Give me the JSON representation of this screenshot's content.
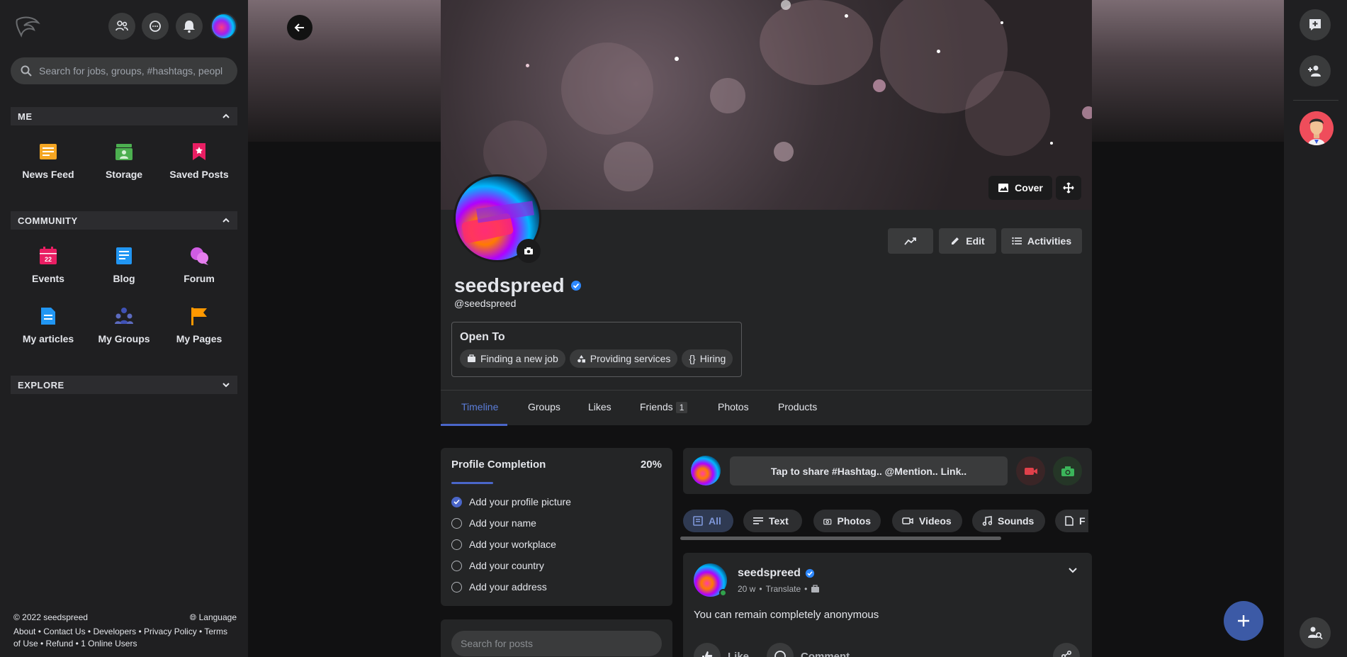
{
  "search": {
    "placeholder": "Search for jobs, groups, #hashtags, peopl"
  },
  "sections": {
    "me": "ME",
    "community": "COMMUNITY",
    "explore": "EXPLORE"
  },
  "me_items": [
    {
      "label": "News Feed",
      "color": "#f5a623"
    },
    {
      "label": "Storage",
      "color": "#4caf50"
    },
    {
      "label": "Saved Posts",
      "color": "#e91e63"
    }
  ],
  "community_items": [
    {
      "label": "Events",
      "color": "#e91e63"
    },
    {
      "label": "Blog",
      "color": "#2196f3"
    },
    {
      "label": "Forum",
      "color": "#d05ce3"
    },
    {
      "label": "My articles",
      "color": "#2196f3"
    },
    {
      "label": "My Groups",
      "color": "#3f51b5"
    },
    {
      "label": "My Pages",
      "color": "#ff9800"
    }
  ],
  "footer": {
    "copyright": "© 2022 seedspreed",
    "language": "Language",
    "links_line1": "About • Contact Us • Developers • Privacy Policy • Terms",
    "links_line2": "of Use • Refund • 1 Online Users"
  },
  "profile": {
    "cover_label": "Cover",
    "edit_label": "Edit",
    "activities_label": "Activities",
    "name": "seedspreed",
    "handle": "@seedspreed",
    "open_to_title": "Open To",
    "open_to_chips": [
      "Finding a new job",
      "Providing services",
      "Hiring"
    ],
    "tabs": [
      "Timeline",
      "Groups",
      "Likes",
      "Friends",
      "Photos",
      "Products"
    ],
    "friends_count": "1"
  },
  "completion": {
    "title": "Profile Completion",
    "percent": "20%",
    "progress": 0.2,
    "items": [
      {
        "label": "Add your profile picture",
        "done": true
      },
      {
        "label": "Add your name",
        "done": false
      },
      {
        "label": "Add your workplace",
        "done": false
      },
      {
        "label": "Add your country",
        "done": false
      },
      {
        "label": "Add your address",
        "done": false
      }
    ]
  },
  "search_posts": {
    "placeholder": "Search for posts"
  },
  "composer": {
    "placeholder": "Tap to share #Hashtag.. @Mention.. Link.."
  },
  "filters": [
    "All",
    "Text",
    "Photos",
    "Videos",
    "Sounds",
    "F"
  ],
  "post": {
    "author": "seedspreed",
    "time": "20 w",
    "translate": "Translate",
    "text": "You can remain completely anonymous",
    "like_label": "Like",
    "comment_label": "Comment"
  },
  "colors": {
    "accent": "#4a66c9",
    "verified": "#2d88ff",
    "online": "#31a24c"
  }
}
